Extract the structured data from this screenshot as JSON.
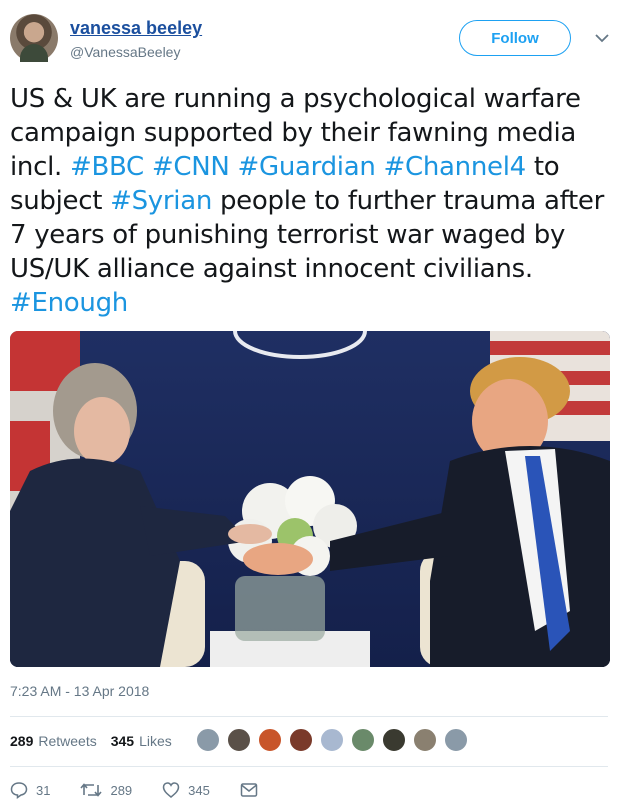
{
  "user": {
    "name": "vanessa beeley",
    "handle": "@VanessaBeeley"
  },
  "follow_label": "Follow",
  "tweet": {
    "lines": [
      [
        {
          "t": "US & UK are running a psychological warfare",
          "tag": false
        }
      ],
      [
        {
          "t": "campaign supported by their fawning media",
          "tag": false
        }
      ],
      [
        {
          "t": "incl. ",
          "tag": false
        },
        {
          "t": "#BBC",
          "tag": true
        },
        {
          "t": " ",
          "tag": false
        },
        {
          "t": "#CNN",
          "tag": true
        },
        {
          "t": " ",
          "tag": false
        },
        {
          "t": "#Guardian",
          "tag": true
        },
        {
          "t": " ",
          "tag": false
        },
        {
          "t": "#Channel4",
          "tag": true
        },
        {
          "t": " to",
          "tag": false
        }
      ],
      [
        {
          "t": "subject ",
          "tag": false
        },
        {
          "t": "#Syrian",
          "tag": true
        },
        {
          "t": " people to further trauma after",
          "tag": false
        }
      ],
      [
        {
          "t": "7 years of punishing terrorist war waged by",
          "tag": false
        }
      ],
      [
        {
          "t": "US/UK alliance against innocent civilians.",
          "tag": false
        }
      ],
      [
        {
          "t": "#Enough",
          "tag": true
        }
      ]
    ],
    "hashtag_color": "#1b95e0"
  },
  "timestamp": "7:23 AM - 13 Apr 2018",
  "stats": {
    "retweets_count": "289",
    "retweets_label": "Retweets",
    "likes_count": "345",
    "likes_label": "Likes"
  },
  "liker_avatar_colors": [
    "#8a9aa8",
    "#5a5048",
    "#c8552a",
    "#7a3a2a",
    "#a8b8d0",
    "#6a8a6a",
    "#3a3a30",
    "#8a8070",
    "#8a9aa8"
  ],
  "actions": {
    "reply_icon": "reply-icon",
    "reply_count": "31",
    "retweet_icon": "retweet-icon",
    "retweet_count": "289",
    "like_icon": "heart-icon",
    "like_count": "345",
    "message_icon": "envelope-icon"
  },
  "accent_color": "#1da1f2"
}
